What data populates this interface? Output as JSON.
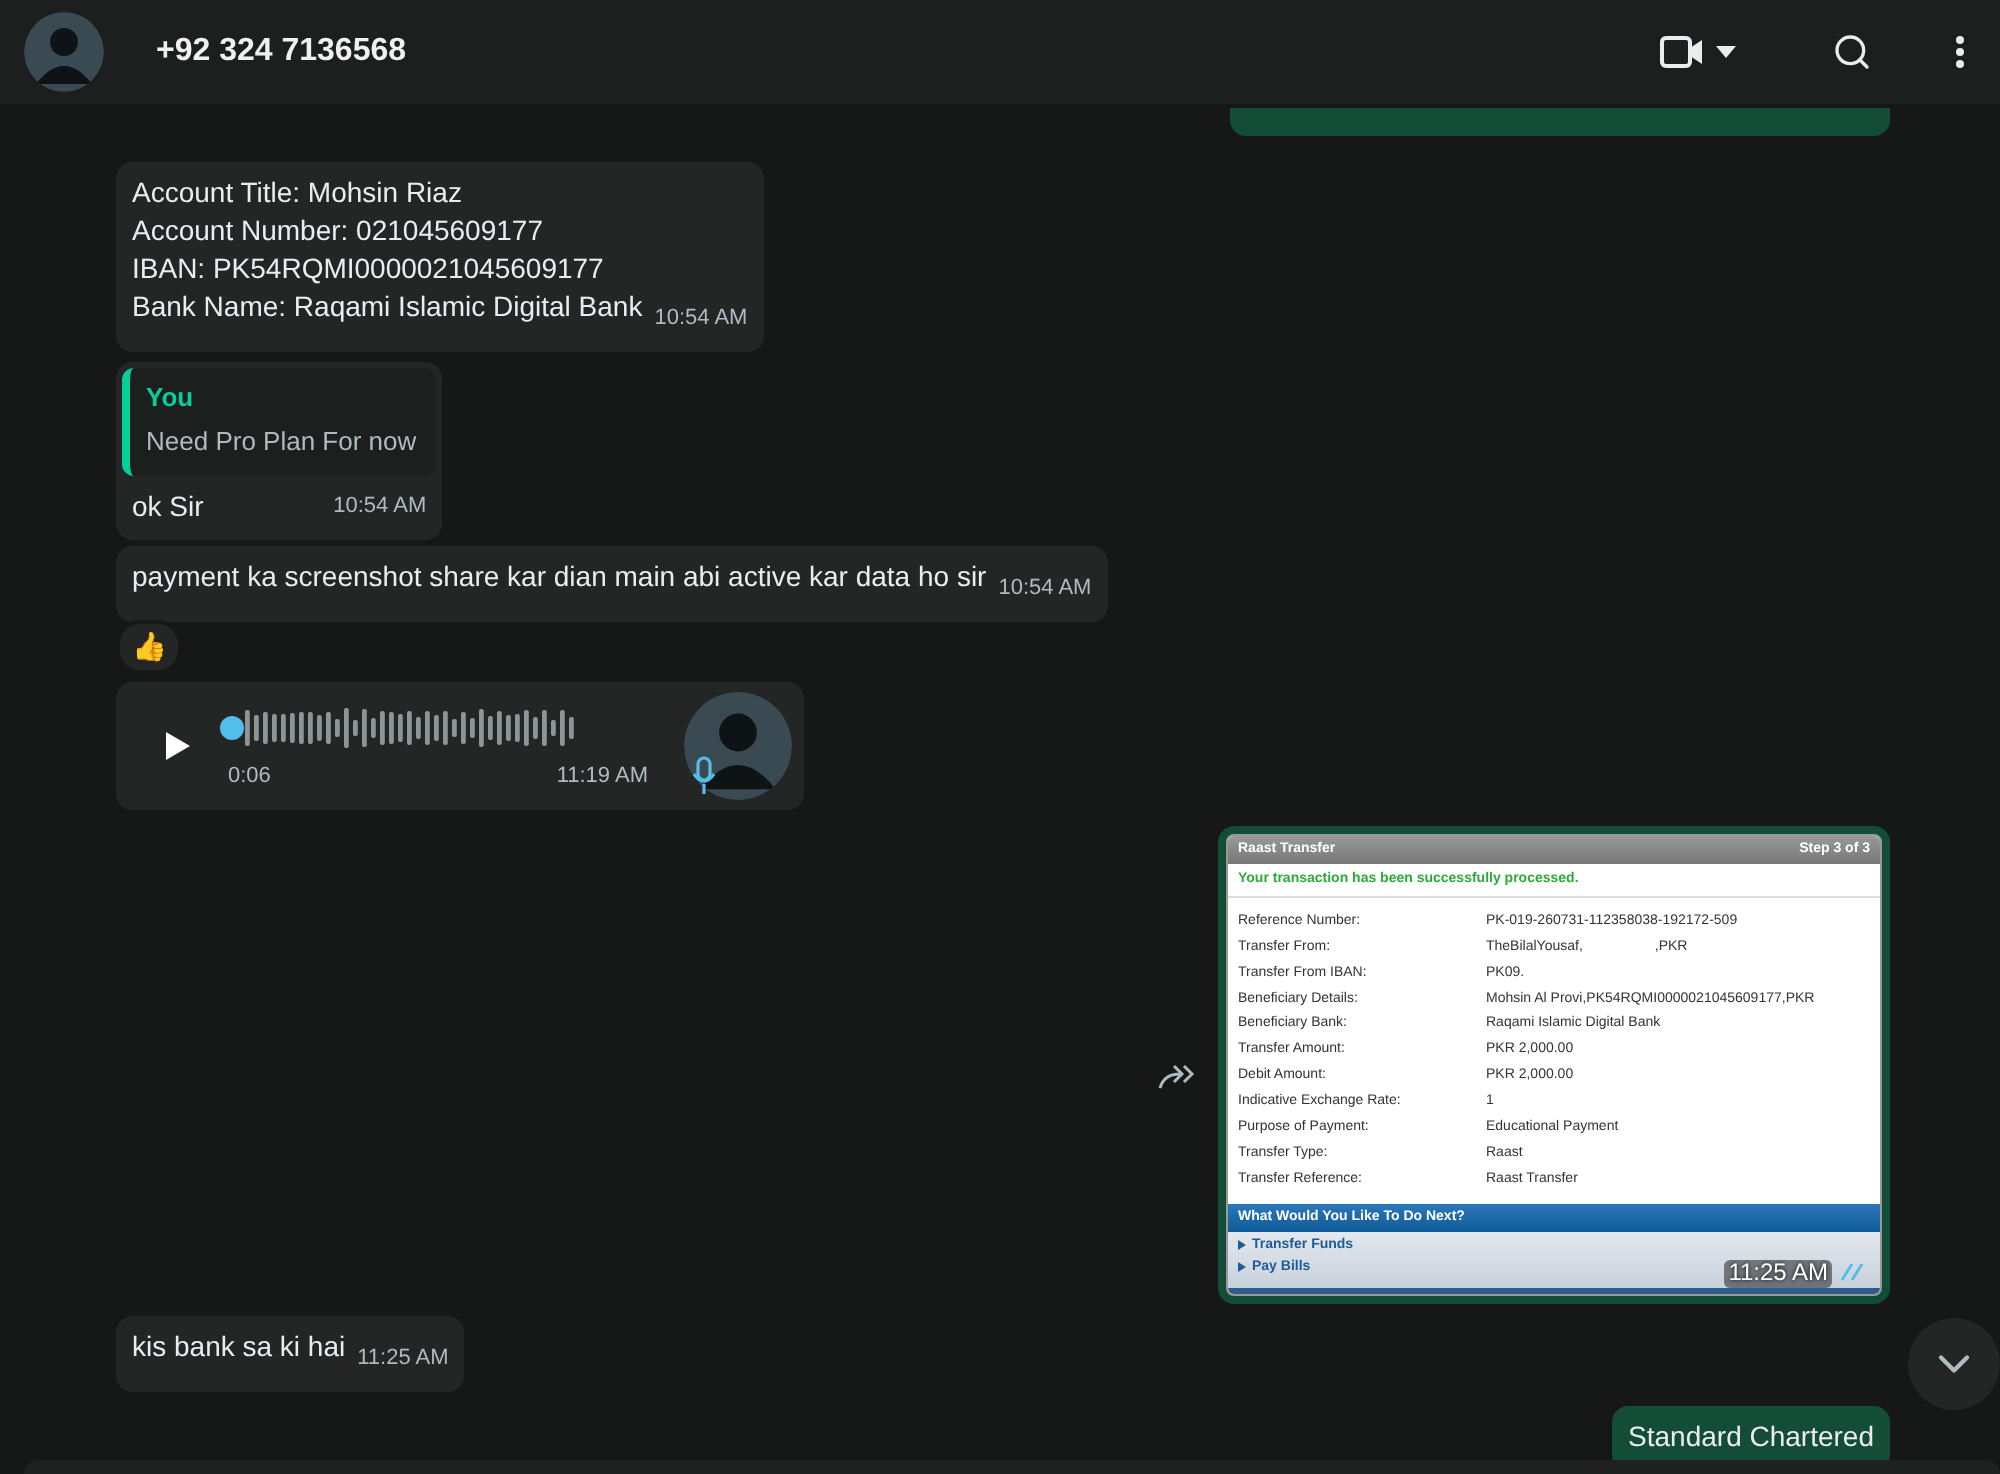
{
  "header": {
    "contact": "+92 324 7136568"
  },
  "messages": [
    {
      "kind": "stub",
      "outgoing": true
    },
    {
      "kind": "text",
      "outgoing": false,
      "lines": [
        "Account Title: Mohsin Riaz",
        "Account Number: 021045609177",
        "IBAN: PK54RQMI0000021045609177",
        "Bank Name: Raqami Islamic Digital Bank"
      ],
      "time": "10:54 AM"
    },
    {
      "kind": "reply",
      "outgoing": false,
      "quote": {
        "author": "You",
        "text": "Need Pro Plan For now"
      },
      "text": "ok Sir",
      "time": "10:54 AM"
    },
    {
      "kind": "text",
      "outgoing": false,
      "lines": [
        "payment ka screenshot share kar dian main abi active kar data ho sir"
      ],
      "time": "10:54 AM",
      "reaction": "👍"
    },
    {
      "kind": "voice",
      "outgoing": false,
      "duration": "0:06",
      "time": "11:19 AM"
    },
    {
      "kind": "image",
      "outgoing": true,
      "forward": true,
      "time": "11:25 AM",
      "read": true,
      "receipt": {
        "title": "Raast Transfer",
        "step": "Step 3 of 3",
        "status": "Your transaction has been successfully processed.",
        "rows": [
          {
            "label": "Reference Number:",
            "value": "PK-019-260731-112358038-192172-509"
          },
          {
            "label": "Transfer From:",
            "value": "TheBilalYousaf,",
            "value_end": ",PKR"
          },
          {
            "label": "Transfer From IBAN:",
            "value": "PK09."
          },
          {
            "label": "Beneficiary Details:",
            "value": "Mohsin Al Provi,PK54RQMI0000021045609177,PKR"
          },
          {
            "label": "Beneficiary Bank:",
            "value": "Raqami Islamic Digital Bank"
          },
          {
            "label": "Transfer Amount:",
            "value": "PKR  2,000.00"
          },
          {
            "label": "Debit Amount:",
            "value": "PKR  2,000.00"
          },
          {
            "label": "Indicative Exchange Rate:",
            "value": "1"
          },
          {
            "label": "Purpose of Payment:",
            "value": "Educational Payment"
          },
          {
            "label": "Transfer Type:",
            "value": "Raast"
          },
          {
            "label": "Transfer Reference:",
            "value": "Raast Transfer"
          }
        ],
        "next_title": "What Would You Like To Do Next?",
        "links": [
          "Transfer Funds",
          "Pay Bills"
        ]
      }
    },
    {
      "kind": "text",
      "outgoing": false,
      "lines": [
        "kis bank sa ki hai"
      ],
      "time": "11:25 AM"
    },
    {
      "kind": "text",
      "outgoing": true,
      "lines": [
        "Standard Chartered"
      ]
    }
  ]
}
